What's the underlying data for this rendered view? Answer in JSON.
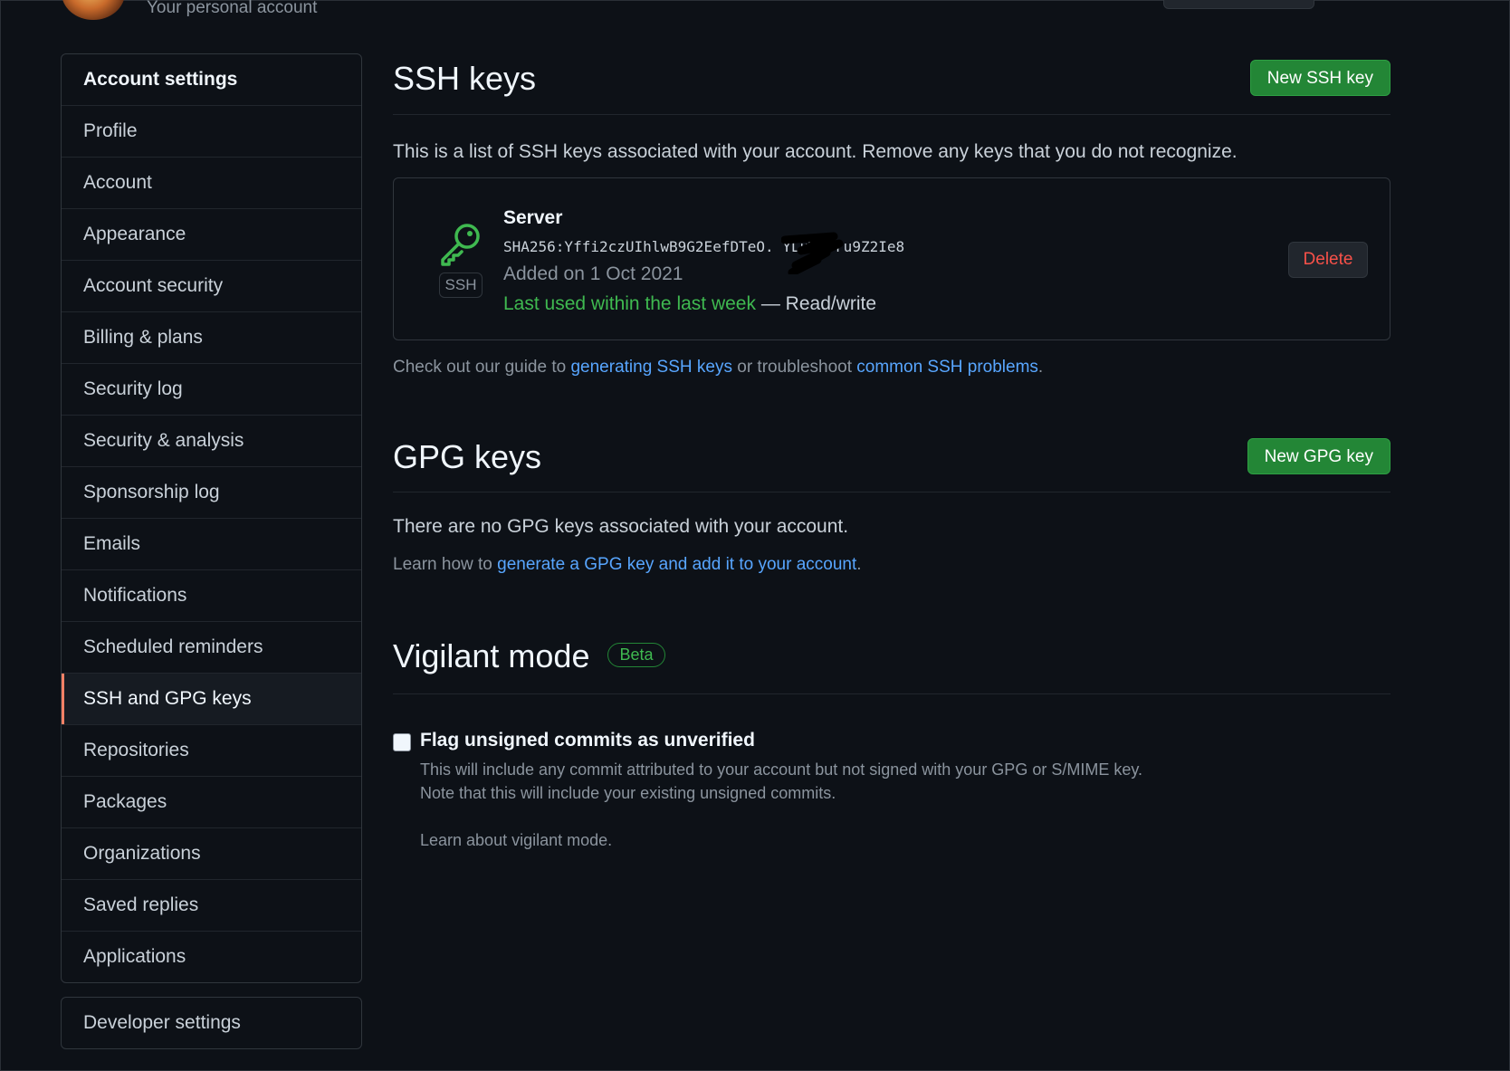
{
  "header": {
    "subtitle": "Your personal account"
  },
  "sidebar": {
    "heading": "Account settings",
    "items": [
      "Profile",
      "Account",
      "Appearance",
      "Account security",
      "Billing & plans",
      "Security log",
      "Security & analysis",
      "Sponsorship log",
      "Emails",
      "Notifications",
      "Scheduled reminders",
      "SSH and GPG keys",
      "Repositories",
      "Packages",
      "Organizations",
      "Saved replies",
      "Applications"
    ],
    "selected": "SSH and GPG keys",
    "developer": "Developer settings"
  },
  "ssh": {
    "title": "SSH keys",
    "new_button": "New SSH key",
    "description": "This is a list of SSH keys associated with your account. Remove any keys that you do not recognize.",
    "key": {
      "name": "Server",
      "badge": "SSH",
      "fingerprint": "SHA256:Yffi2czUIhlwB9G2EefDTeO.      YLuWGoru9Z2Ie8",
      "added": "Added on 1 Oct 2021",
      "last_used": "Last used within the last week",
      "access": " — Read/write",
      "delete_label": "Delete"
    },
    "guide_prefix": "Check out our guide to ",
    "guide_link1": "generating SSH keys",
    "guide_mid": " or troubleshoot ",
    "guide_link2": "common SSH problems",
    "guide_suffix": "."
  },
  "gpg": {
    "title": "GPG keys",
    "new_button": "New GPG key",
    "empty": "There are no GPG keys associated with your account.",
    "learn_prefix": "Learn how to ",
    "learn_link": "generate a GPG key and add it to your account",
    "learn_suffix": "."
  },
  "vigilant": {
    "title": "Vigilant mode",
    "badge": "Beta",
    "checkbox_label": "Flag unsigned commits as unverified",
    "desc1": "This will include any commit attributed to your account but not signed with your GPG or S/MIME key.",
    "desc2": "Note that this will include your existing unsigned commits.",
    "learn_link": "Learn about vigilant mode."
  },
  "colors": {
    "background": "#0d1117",
    "accent_green": "#238636",
    "link_blue": "#58a6ff",
    "danger_red": "#f85149",
    "selected_marker": "#f78166"
  }
}
